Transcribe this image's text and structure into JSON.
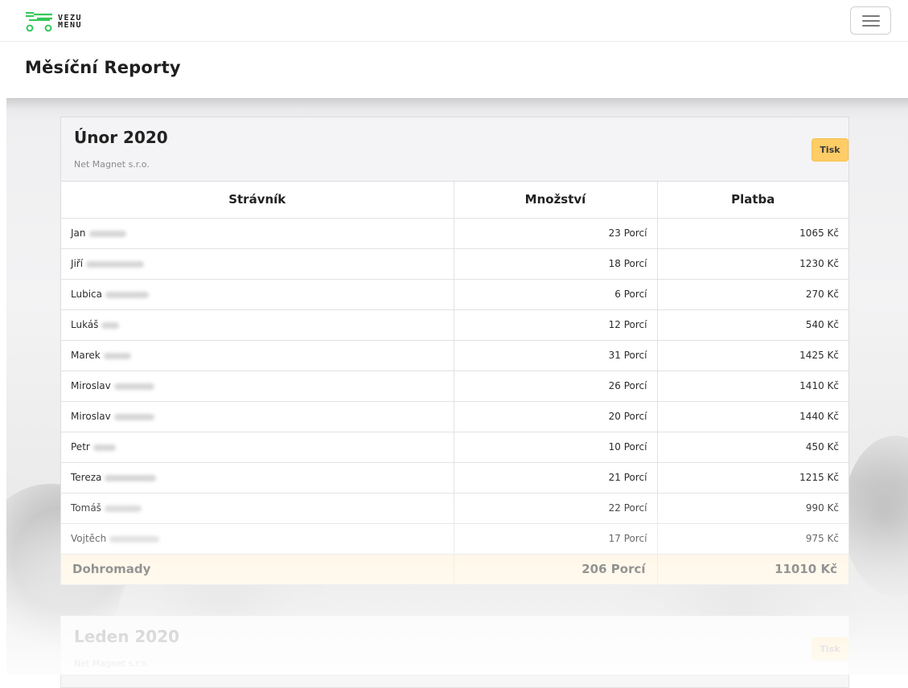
{
  "brand": {
    "line1": "VEZU",
    "line2": "MENU",
    "accent": "#34c759"
  },
  "page": {
    "title": "Měsíční Reporty"
  },
  "reports": [
    {
      "period": "Únor 2020",
      "company": "Net Magnet s.r.o.",
      "print_label": "Tisk",
      "columns": [
        "Strávník",
        "Množství",
        "Platba"
      ],
      "rows": [
        {
          "name": "Jan",
          "qty": "23 Porcí",
          "pay": "1065 Kč"
        },
        {
          "name": "Jiří",
          "qty": "18 Porcí",
          "pay": "1230 Kč"
        },
        {
          "name": "Lubica",
          "qty": "6 Porcí",
          "pay": "270 Kč"
        },
        {
          "name": "Lukáš",
          "qty": "12 Porcí",
          "pay": "540 Kč"
        },
        {
          "name": "Marek",
          "qty": "31 Porcí",
          "pay": "1425 Kč"
        },
        {
          "name": "Miroslav",
          "qty": "26 Porcí",
          "pay": "1410 Kč"
        },
        {
          "name": "Miroslav",
          "qty": "20 Porcí",
          "pay": "1440 Kč"
        },
        {
          "name": "Petr",
          "qty": "10 Porcí",
          "pay": "450 Kč"
        },
        {
          "name": "Tereza",
          "qty": "21 Porcí",
          "pay": "1215 Kč"
        },
        {
          "name": "Tomáš",
          "qty": "22 Porcí",
          "pay": "990 Kč"
        },
        {
          "name": "Vojtěch",
          "qty": "17 Porcí",
          "pay": "975 Kč"
        }
      ],
      "total": {
        "label": "Dohromady",
        "qty": "206 Porcí",
        "pay": "11010 Kč"
      }
    },
    {
      "period": "Leden 2020",
      "company": "Net Magnet s.r.o.",
      "print_label": "Tisk"
    }
  ],
  "colors": {
    "print_button": "#ffcc66",
    "total_row": "#fff3dc"
  }
}
